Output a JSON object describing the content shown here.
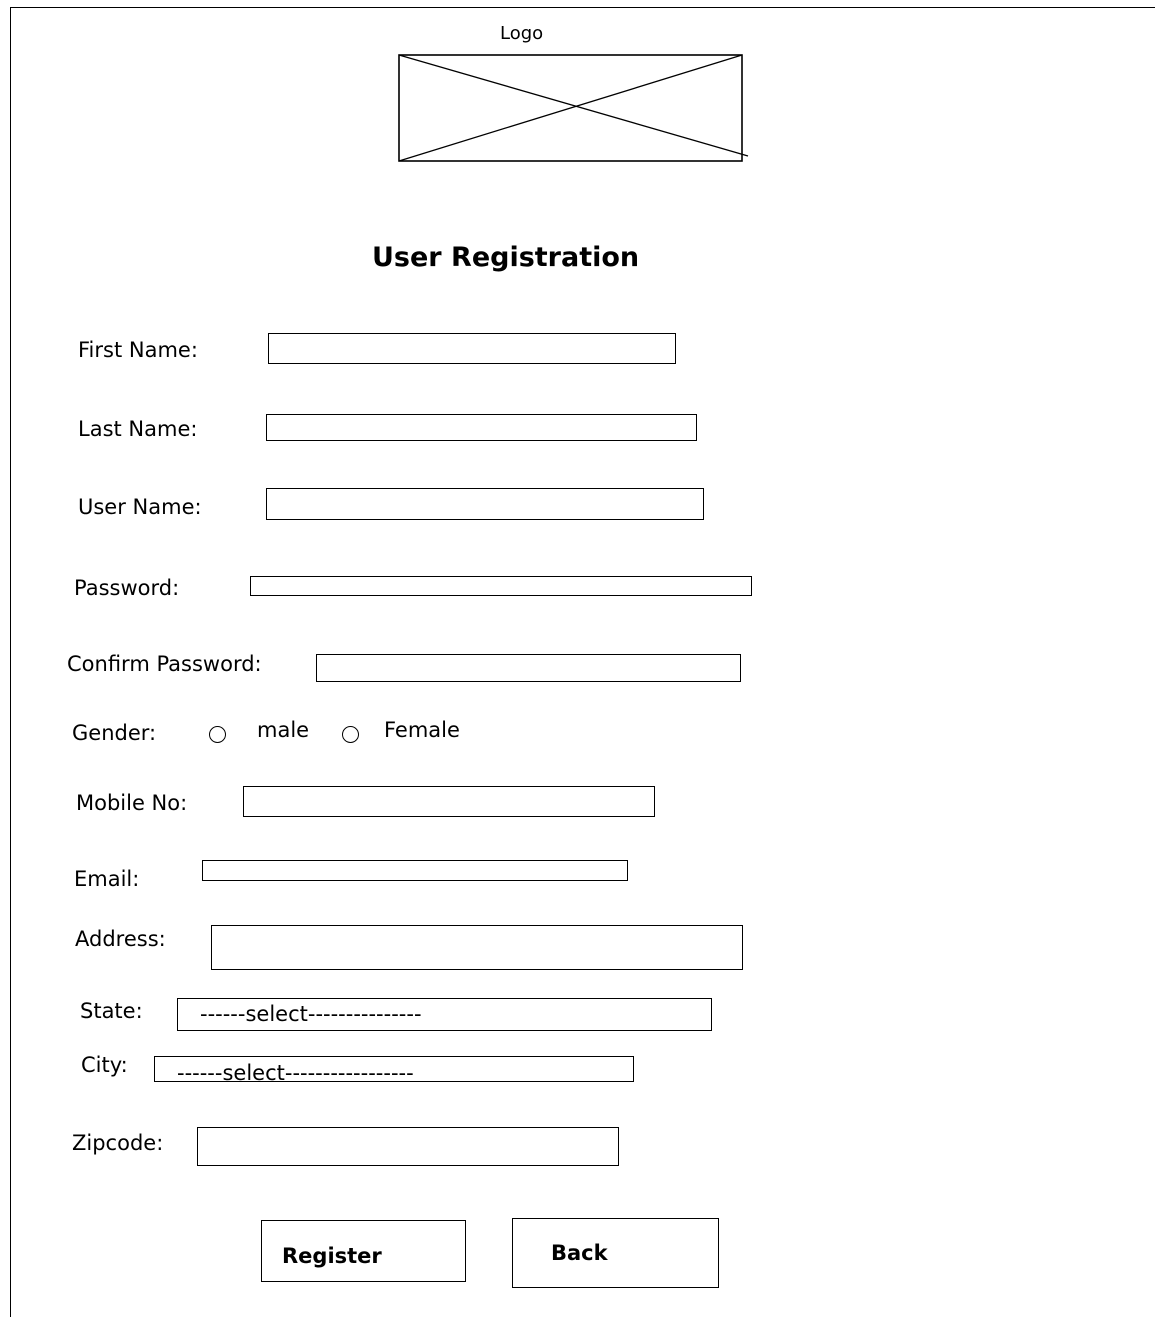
{
  "logo": {
    "label": "Logo"
  },
  "header": {
    "title": "User Registration"
  },
  "form": {
    "first_name": {
      "label": "First Name:",
      "value": ""
    },
    "last_name": {
      "label": "Last Name:",
      "value": ""
    },
    "user_name": {
      "label": "User Name:",
      "value": ""
    },
    "password": {
      "label": "Password:",
      "value": ""
    },
    "confirm_password": {
      "label": "Confirm Password:",
      "value": ""
    },
    "gender": {
      "label": "Gender:",
      "options": [
        {
          "label": "male",
          "selected": false
        },
        {
          "label": "Female",
          "selected": false
        }
      ]
    },
    "mobile": {
      "label": "Mobile No:",
      "value": ""
    },
    "email": {
      "label": "Email:",
      "value": ""
    },
    "address": {
      "label": "Address:",
      "value": ""
    },
    "state": {
      "label": "State:",
      "selected": "------select---------------"
    },
    "city": {
      "label": "City:",
      "selected": "------select-----------------"
    },
    "zipcode": {
      "label": "Zipcode:",
      "value": ""
    }
  },
  "buttons": {
    "register": "Register",
    "back": "Back"
  }
}
